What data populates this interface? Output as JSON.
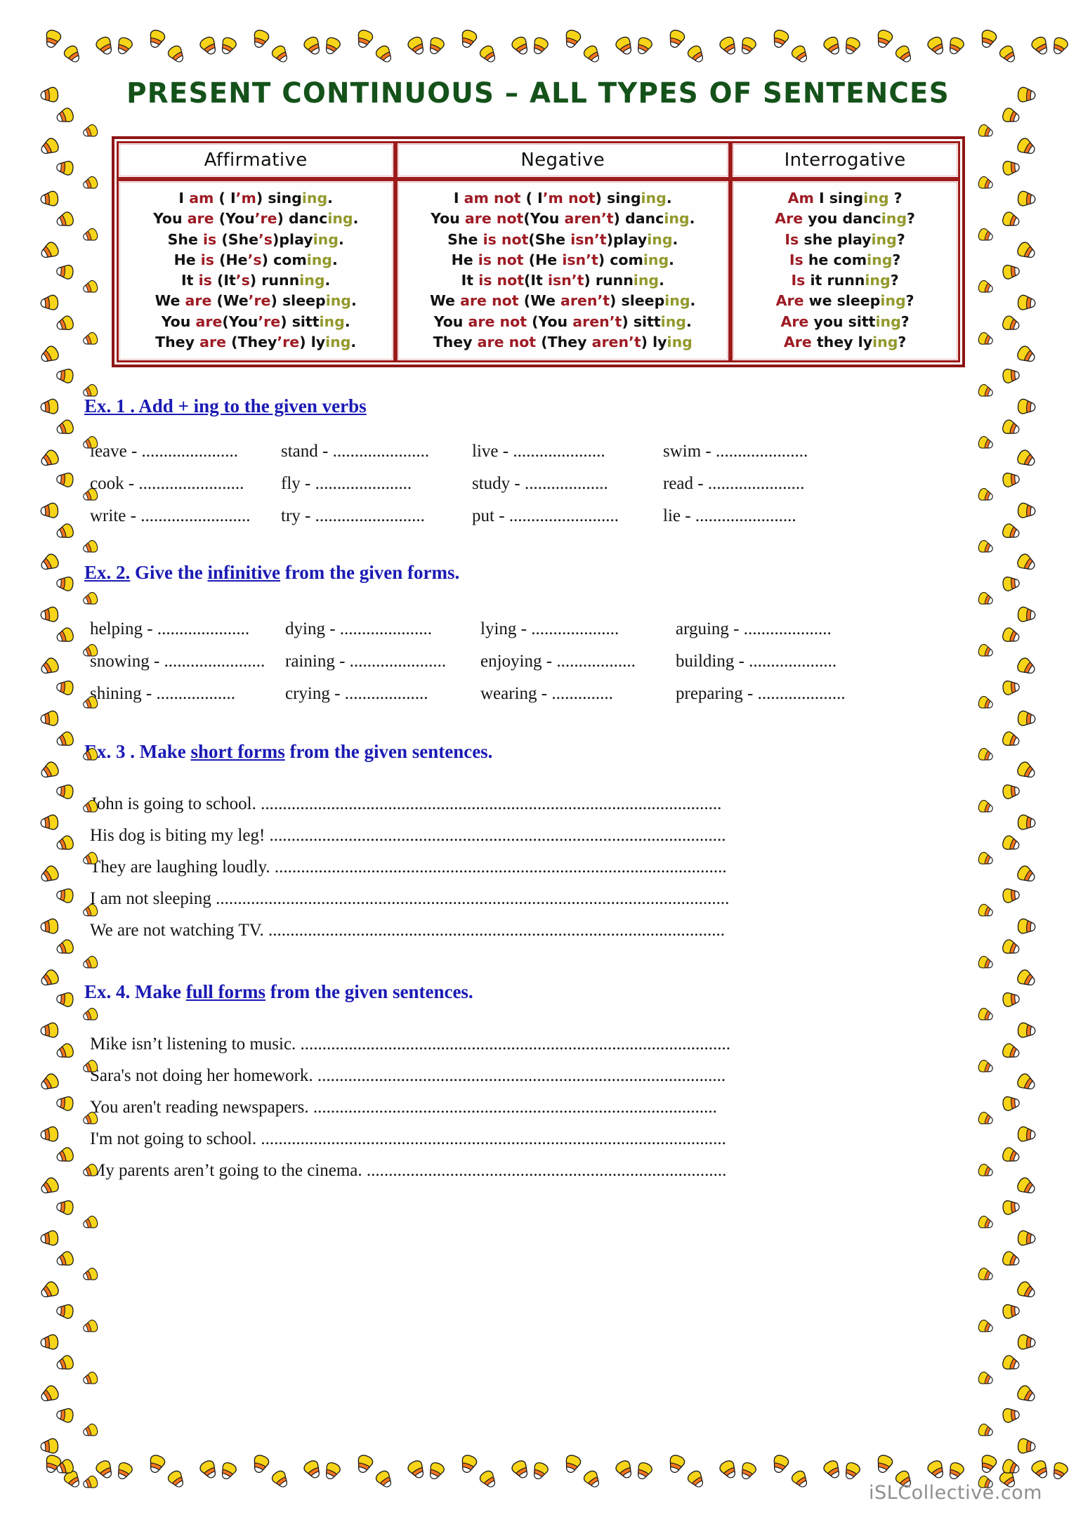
{
  "title": "PRESENT CONTINUOUS – ALL TYPES OF SENTENCES",
  "colors": {
    "title_green": "#14521a",
    "aux_red": "#9e1b24",
    "ing_olive": "#93992c",
    "heading_blue": "#1a1ab4",
    "table_border": "#9d1b1b",
    "candy_orange": "#f4741e",
    "candy_yellow": "#f7d417",
    "watermark_gray": "#8e8e8e"
  },
  "table": {
    "headers": [
      "Affirmative",
      "Negative",
      "Interrogative"
    ],
    "affirmative": [
      [
        [
          "I ",
          ""
        ],
        [
          "am",
          "r"
        ],
        [
          " ( I",
          ""
        ],
        [
          "’m",
          "r"
        ],
        [
          ") sing",
          ""
        ],
        [
          "ing",
          "g"
        ],
        [
          ".",
          ""
        ]
      ],
      [
        [
          "You ",
          ""
        ],
        [
          "are",
          "r"
        ],
        [
          " (You",
          ""
        ],
        [
          "’re",
          "r"
        ],
        [
          ") danc",
          ""
        ],
        [
          "ing",
          "g"
        ],
        [
          ".",
          ""
        ]
      ],
      [
        [
          "She ",
          ""
        ],
        [
          "is",
          "r"
        ],
        [
          " (She",
          ""
        ],
        [
          "’s",
          "r"
        ],
        [
          ")play",
          ""
        ],
        [
          "ing",
          "g"
        ],
        [
          ".",
          ""
        ]
      ],
      [
        [
          "He ",
          ""
        ],
        [
          "is",
          "r"
        ],
        [
          " (He",
          ""
        ],
        [
          "’s",
          "r"
        ],
        [
          ") com",
          ""
        ],
        [
          "ing",
          "g"
        ],
        [
          ".",
          ""
        ]
      ],
      [
        [
          "It ",
          ""
        ],
        [
          "is",
          "r"
        ],
        [
          " (It",
          ""
        ],
        [
          "’s",
          "r"
        ],
        [
          ") runn",
          ""
        ],
        [
          "ing",
          "g"
        ],
        [
          ".",
          ""
        ]
      ],
      [
        [
          "We ",
          ""
        ],
        [
          "are",
          "r"
        ],
        [
          " (We",
          ""
        ],
        [
          "’re",
          "r"
        ],
        [
          ") sleep",
          ""
        ],
        [
          "ing",
          "g"
        ],
        [
          ".",
          ""
        ]
      ],
      [
        [
          "You ",
          ""
        ],
        [
          "are",
          "r"
        ],
        [
          "(You",
          ""
        ],
        [
          "’re",
          "r"
        ],
        [
          ") sitt",
          ""
        ],
        [
          "ing",
          "g"
        ],
        [
          ".",
          ""
        ]
      ],
      [
        [
          "They ",
          ""
        ],
        [
          "are",
          "r"
        ],
        [
          " (They",
          ""
        ],
        [
          "’re",
          "r"
        ],
        [
          ") ly",
          ""
        ],
        [
          "ing",
          "g"
        ],
        [
          ".",
          ""
        ]
      ]
    ],
    "negative": [
      [
        [
          "I ",
          ""
        ],
        [
          "am not",
          "r"
        ],
        [
          " ( I",
          ""
        ],
        [
          "’m not",
          "r"
        ],
        [
          ") sing",
          ""
        ],
        [
          "ing",
          "g"
        ],
        [
          ".",
          ""
        ]
      ],
      [
        [
          "You ",
          ""
        ],
        [
          "are not",
          "r"
        ],
        [
          "(You ",
          ""
        ],
        [
          "aren’t",
          "r"
        ],
        [
          ") danc",
          ""
        ],
        [
          "ing",
          "g"
        ],
        [
          ".",
          ""
        ]
      ],
      [
        [
          "She ",
          ""
        ],
        [
          "is not",
          "r"
        ],
        [
          "(She ",
          ""
        ],
        [
          "isn’t",
          "r"
        ],
        [
          ")play",
          ""
        ],
        [
          "ing",
          "g"
        ],
        [
          ".",
          ""
        ]
      ],
      [
        [
          "He ",
          ""
        ],
        [
          "is not",
          "r"
        ],
        [
          " (He ",
          ""
        ],
        [
          "isn’t",
          "r"
        ],
        [
          ") com",
          ""
        ],
        [
          "ing",
          "g"
        ],
        [
          ".",
          ""
        ]
      ],
      [
        [
          "It ",
          ""
        ],
        [
          "is not",
          "r"
        ],
        [
          "(It ",
          ""
        ],
        [
          "isn’t",
          "r"
        ],
        [
          ") runn",
          ""
        ],
        [
          "ing",
          "g"
        ],
        [
          ".",
          ""
        ]
      ],
      [
        [
          "We ",
          ""
        ],
        [
          "are not",
          "r"
        ],
        [
          " (We ",
          ""
        ],
        [
          "aren’t",
          "r"
        ],
        [
          ") sleep",
          ""
        ],
        [
          "ing",
          "g"
        ],
        [
          ".",
          ""
        ]
      ],
      [
        [
          "You ",
          ""
        ],
        [
          "are not",
          "r"
        ],
        [
          " (You ",
          ""
        ],
        [
          "aren’t",
          "r"
        ],
        [
          ") sitt",
          ""
        ],
        [
          "ing",
          "g"
        ],
        [
          ".",
          ""
        ]
      ],
      [
        [
          "They ",
          ""
        ],
        [
          "are not",
          "r"
        ],
        [
          " (They ",
          ""
        ],
        [
          "aren’t",
          "r"
        ],
        [
          ") ly",
          ""
        ],
        [
          "ing",
          "g"
        ],
        [
          "",
          ""
        ]
      ]
    ],
    "interrogative": [
      [
        [
          "Am",
          "r"
        ],
        [
          " I sing",
          ""
        ],
        [
          "ing",
          "g"
        ],
        [
          " ?",
          ""
        ]
      ],
      [
        [
          "Are",
          "r"
        ],
        [
          " you danc",
          ""
        ],
        [
          "ing",
          "g"
        ],
        [
          "?",
          ""
        ]
      ],
      [
        [
          "Is",
          "r"
        ],
        [
          " she play",
          ""
        ],
        [
          "ing",
          "g"
        ],
        [
          "?",
          ""
        ]
      ],
      [
        [
          "Is",
          "r"
        ],
        [
          " he com",
          ""
        ],
        [
          "ing",
          "g"
        ],
        [
          "?",
          ""
        ]
      ],
      [
        [
          "Is",
          "r"
        ],
        [
          " it runn",
          ""
        ],
        [
          "ing",
          "g"
        ],
        [
          "?",
          ""
        ]
      ],
      [
        [
          "Are",
          "r"
        ],
        [
          " we sleep",
          ""
        ],
        [
          "ing",
          "g"
        ],
        [
          "?",
          ""
        ]
      ],
      [
        [
          "Are",
          "r"
        ],
        [
          " you sitt",
          ""
        ],
        [
          "ing",
          "g"
        ],
        [
          "?",
          ""
        ]
      ],
      [
        [
          "Are",
          "r"
        ],
        [
          " they ly",
          ""
        ],
        [
          "ing",
          "g"
        ],
        [
          "?",
          ""
        ]
      ]
    ]
  },
  "exercises": {
    "ex1": {
      "heading_plain_pre": "",
      "heading_underlined": "Ex. 1 . Add + ing to the given verbs",
      "heading_plain_post": "",
      "words": [
        "leave - ......................",
        "stand - ......................",
        "live - .....................",
        "swim - .....................",
        "cook - ........................",
        "fly - ......................",
        "study - ...................",
        "read - ......................",
        "write - .........................",
        "try - .........................",
        "put - .........................",
        "lie - ......................."
      ]
    },
    "ex2": {
      "heading_pre": "",
      "heading_u1": "Ex. 2.",
      "heading_mid": " Give the ",
      "heading_u2": "infinitive",
      "heading_post": " from the given forms.",
      "words": [
        "helping - .....................",
        "dying - .....................",
        "lying - ....................",
        "arguing - ....................",
        "snowing - .......................",
        "raining - ......................",
        "enjoying - ..................",
        "building - ....................",
        "shining - ..................",
        "crying - ...................",
        "wearing - ..............",
        "preparing - ...................."
      ]
    },
    "ex3": {
      "heading_pre": "Ex. 3 . Make ",
      "heading_u": "short forms",
      "heading_post": " from the given sentences.",
      "sentences": [
        "John is going to school. .........................................................................................................",
        "His dog is biting my leg! ........................................................................................................",
        "They are laughing loudly. .......................................................................................................",
        "I am not sleeping .....................................................................................................................",
        "We are not watching TV. ........................................................................................................"
      ]
    },
    "ex4": {
      "heading_pre": "Ex. 4. Make ",
      "heading_u": "full forms",
      "heading_post": " from the given sentences.",
      "sentences": [
        "Mike isn’t listening to music. ..................................................................................................",
        "Sara's not doing her homework. .............................................................................................",
        "You aren't reading  newspapers. ............................................................................................",
        "I'm not going to school. ..........................................................................................................",
        "My parents aren’t going to the cinema. .................................................................................."
      ]
    }
  },
  "watermark": "iSLCollective.com"
}
